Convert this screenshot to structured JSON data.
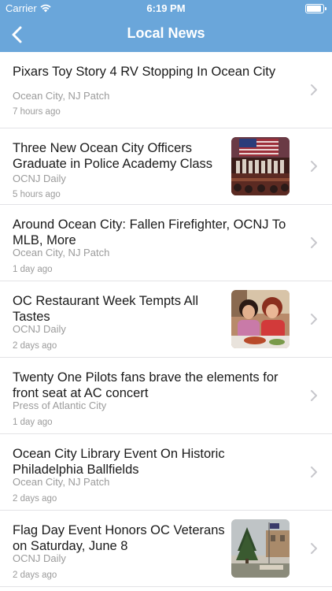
{
  "status_bar": {
    "carrier": "Carrier",
    "time": "6:19 PM"
  },
  "nav": {
    "title": "Local News",
    "back_icon": "chevron-left-icon"
  },
  "colors": {
    "header": "#6aa6da",
    "title_text": "#1a1a1a",
    "meta_text": "#9b9b9b",
    "separator": "#e3e3e6"
  },
  "articles": [
    {
      "title": "Pixars Toy Story 4 RV Stopping In Ocean City",
      "source": "Ocean City, NJ Patch",
      "time": "7 hours ago",
      "has_image": false
    },
    {
      "title": "Three New Ocean City Officers Graduate in Police Academy Class",
      "source": "OCNJ Daily",
      "time": "5 hours ago",
      "has_image": true
    },
    {
      "title": "Around Ocean City: Fallen Firefighter, OCNJ To MLB, More",
      "source": "Ocean City, NJ Patch",
      "time": "1 day ago",
      "has_image": false
    },
    {
      "title": "OC Restaurant Week Tempts All Tastes",
      "source": "OCNJ Daily",
      "time": "2 days ago",
      "has_image": true
    },
    {
      "title": "Twenty One Pilots fans brave the elements for front seat at AC concert",
      "source": "Press of Atlantic City",
      "time": "1 day ago",
      "has_image": false
    },
    {
      "title": "Ocean City Library Event On Historic Philadelphia Ballfields",
      "source": "Ocean City, NJ Patch",
      "time": "2 days ago",
      "has_image": false
    },
    {
      "title": "Flag Day Event Honors OC Veterans on Saturday, June 8",
      "source": "OCNJ Daily",
      "time": "2 days ago",
      "has_image": true
    }
  ]
}
